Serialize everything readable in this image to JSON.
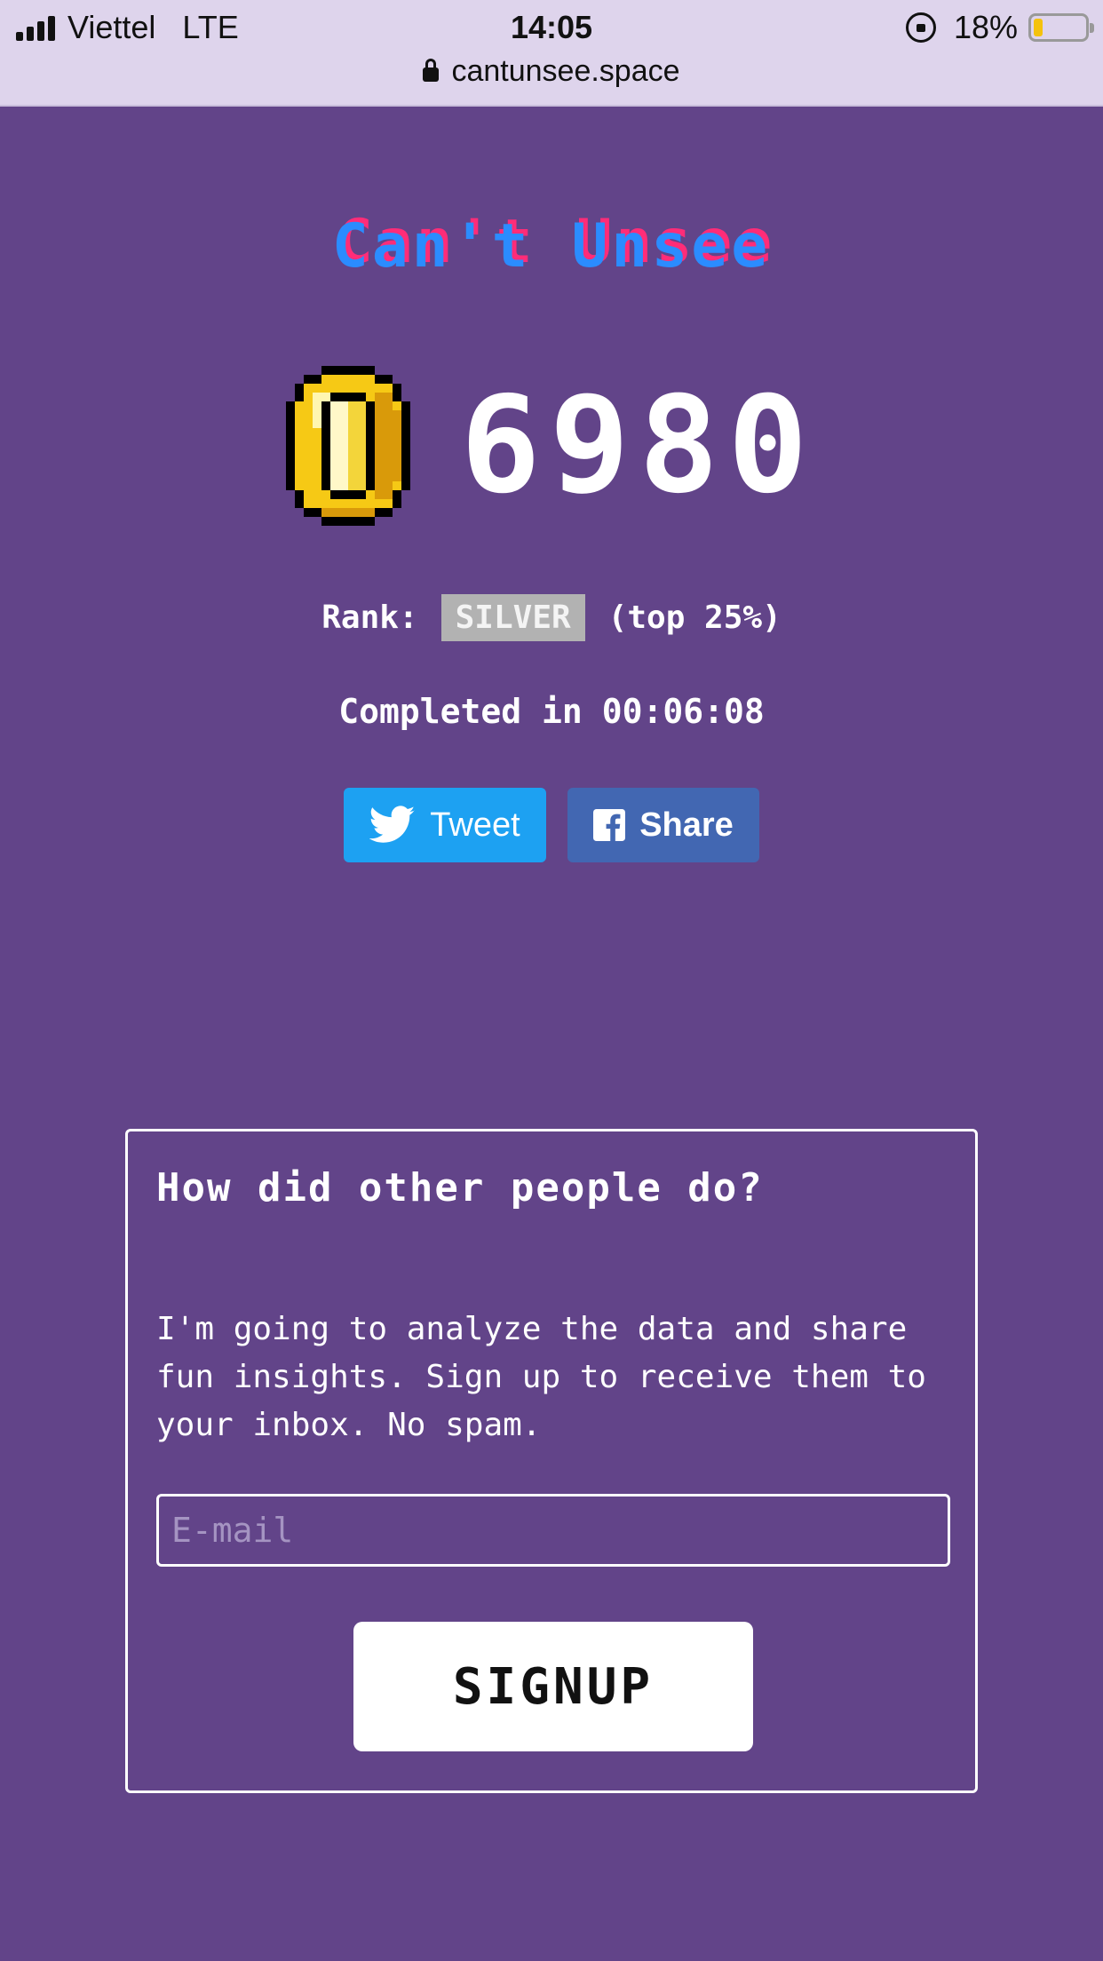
{
  "status_bar": {
    "carrier": "Viettel",
    "network": "LTE",
    "time": "14:05",
    "battery_percent_label": "18%",
    "battery_level": 0.18
  },
  "browser": {
    "url": "cantunsee.space"
  },
  "game": {
    "title": "Can't Unsee",
    "score": "6980",
    "rank_label": "Rank:",
    "rank": "SILVER",
    "rank_detail": "(top 25%)",
    "completed_label": "Completed in",
    "completed_time": "00:06:08"
  },
  "share": {
    "tweet_label": "Tweet",
    "share_label": "Share"
  },
  "signup": {
    "heading": "How did other people do?",
    "body": "I'm going to analyze the data and share fun insights. Sign up to receive them to your inbox. No spam.",
    "email_placeholder": "E-mail",
    "email_value": "",
    "button_label": "SIGNUP"
  },
  "colors": {
    "background": "#624489",
    "title_blue": "#2b8cff",
    "title_pink": "#ff2c78",
    "rank_badge": "#b2b2b2",
    "twitter": "#1da1f2",
    "facebook": "#4267b2",
    "coin_gold": "#f6c915"
  },
  "icons": {
    "coin": "pixel-coin-icon",
    "tweet": "twitter-bird-icon",
    "share": "facebook-icon",
    "address_lock": "padlock-icon",
    "rotation_lock": "rotation-lock-icon"
  }
}
